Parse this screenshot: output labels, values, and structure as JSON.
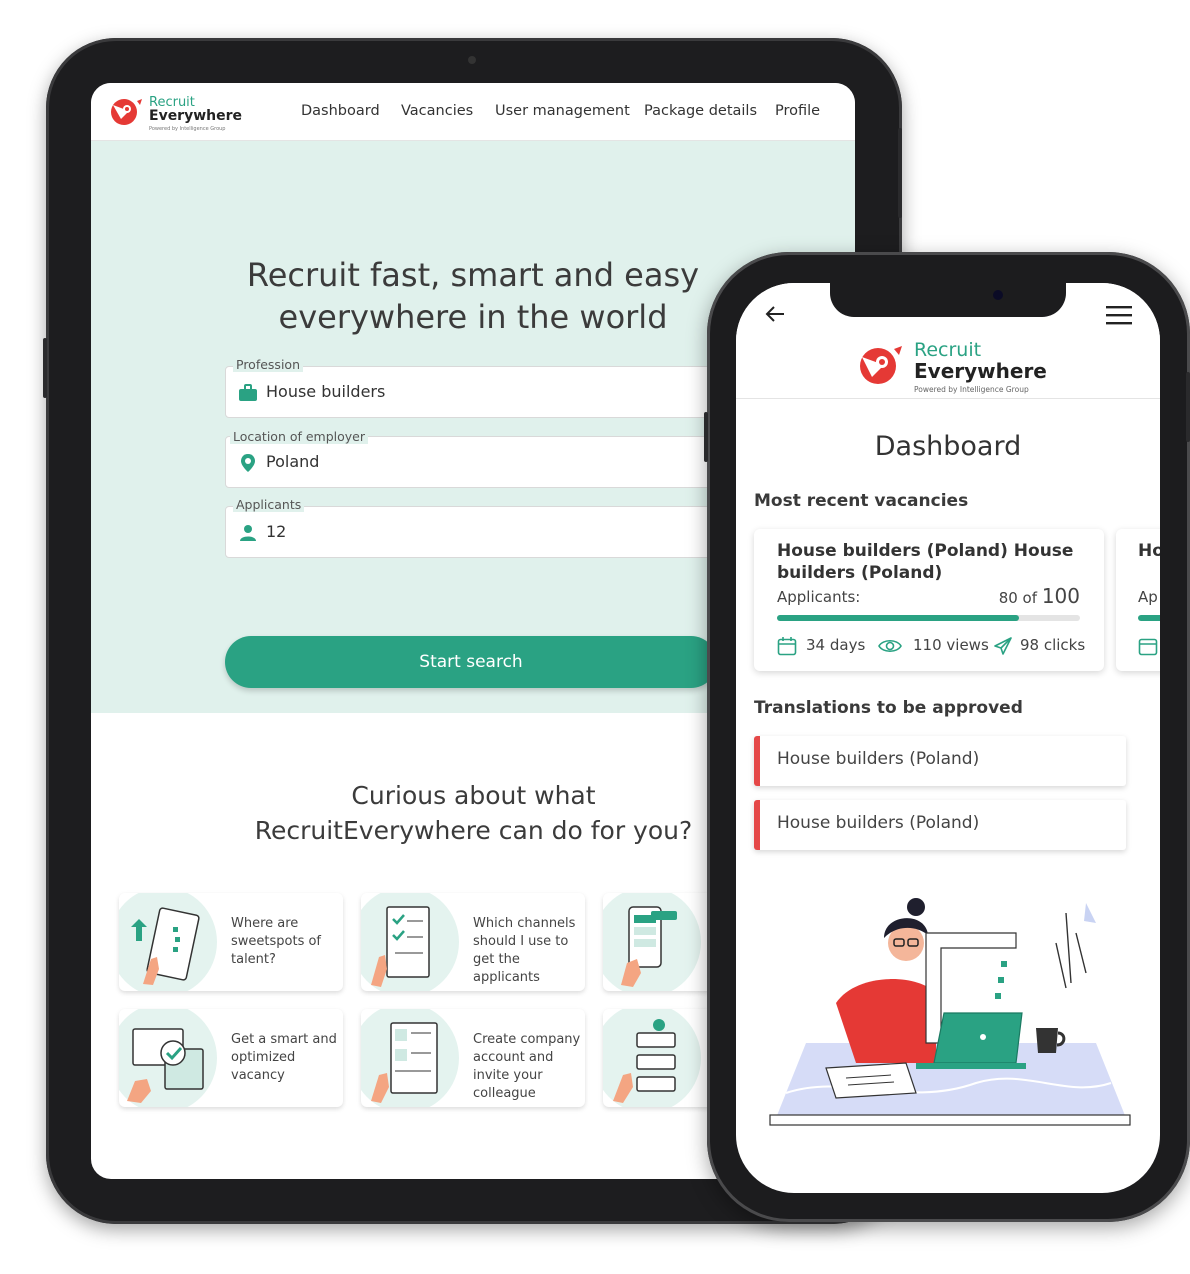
{
  "tablet": {
    "logo": {
      "line1": "Recruit",
      "line2": "Everywhere",
      "tagline": "Powered by Intelligence Group"
    },
    "nav": [
      "Dashboard",
      "Vacancies",
      "User management",
      "Package details",
      "Profile"
    ],
    "hero": {
      "title_line1": "Recruit fast, smart and easy",
      "title_line2": "everywhere in the world",
      "fields": [
        {
          "label": "Profession",
          "value": "House builders",
          "icon": "briefcase-icon"
        },
        {
          "label": "Location of employer",
          "value": "Poland",
          "icon": "location-pin-icon"
        },
        {
          "label": "Applicants",
          "value": "12",
          "icon": "person-icon"
        }
      ],
      "search_button": "Start search"
    },
    "curious": {
      "line1": "Curious about what",
      "line2": "RecruitEverywhere can do for you?"
    },
    "features": [
      {
        "text": "Where are sweetspots of talent?"
      },
      {
        "text": "Which channels should I use to get the applicants"
      },
      {
        "text": ""
      },
      {
        "text": "Get a smart and optimized vacancy"
      },
      {
        "text": "Create company account and invite your colleague"
      },
      {
        "text": ""
      }
    ]
  },
  "phone": {
    "logo": {
      "line1": "Recruit",
      "line2": "Everywhere",
      "tagline": "Powered by Intelligence Group"
    },
    "title": "Dashboard",
    "recent_heading": "Most recent vacancies",
    "vacancy": {
      "title": "House builders (Poland) House builders (Poland)",
      "applicants_label": "Applicants:",
      "count_prefix": "80 of",
      "count_total": "100",
      "progress": 0.8,
      "days": "34 days",
      "views": "110 views",
      "clicks": "98 clicks"
    },
    "vacancy_peek": {
      "title": "Ho",
      "label": "Ap"
    },
    "translations_heading": "Translations to be approved",
    "translations": [
      "House builders (Poland)",
      "House builders (Poland)"
    ]
  },
  "colors": {
    "brand_green": "#2aa283",
    "hero_bg": "#e0f1ec",
    "accent_red": "#e54848"
  }
}
